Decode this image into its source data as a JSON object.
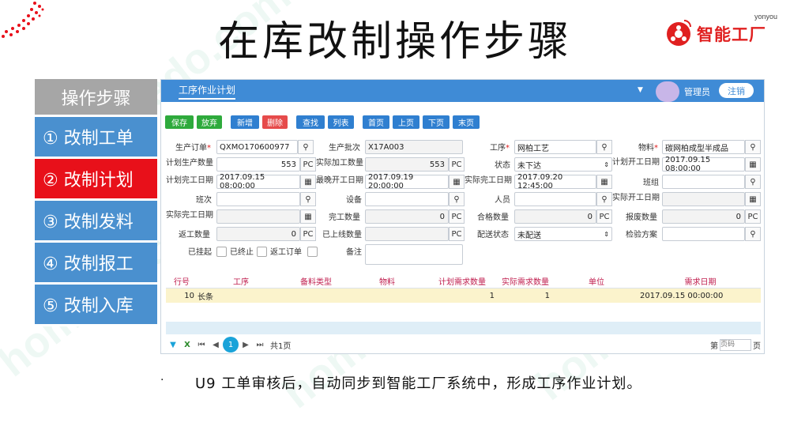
{
  "slide": {
    "title": "在库改制操作步骤",
    "caption_bullet": "·",
    "caption": "U9 工单审核后，自动同步到智能工厂系统中，形成工序作业计划。",
    "watermark": "homedo.com"
  },
  "brand": {
    "top": "yonyou",
    "name": "智能工厂"
  },
  "steps": {
    "header": "操作步骤",
    "items": [
      {
        "label": "① 改制工单",
        "active": false
      },
      {
        "label": "② 改制计划",
        "active": true
      },
      {
        "label": "③ 改制发料",
        "active": false
      },
      {
        "label": "④ 改制报工",
        "active": false
      },
      {
        "label": "⑤ 改制入库",
        "active": false
      }
    ]
  },
  "app": {
    "tab": "工序作业计划",
    "user": "管理员",
    "logout": "注销",
    "toolbar": {
      "save": "保存",
      "discard": "放弃",
      "add": "新增",
      "delete": "删除",
      "search": "查找",
      "list": "列表",
      "first": "首页",
      "prev": "上页",
      "next": "下页",
      "last": "末页"
    },
    "form": {
      "order_label": "生产订单",
      "order": "QXMO170600977",
      "batch_label": "生产批次",
      "batch": "X17A003",
      "process_label": "工序",
      "process": "网柏工艺",
      "material_label": "物料",
      "material": "碳网柏成型半成品",
      "plan_qty_label": "计划生产数量",
      "plan_qty": "553",
      "actual_qty_label": "实际加工数量",
      "actual_qty": "553",
      "status_label": "状态",
      "status": "未下达",
      "plan_start_label": "计划开工日期",
      "plan_start": "2017.09.15 08:00:00",
      "plan_end_label": "计划完工日期",
      "plan_end": "2017.09.15 08:00:00",
      "latest_start_label": "最晚开工日期",
      "latest_start": "2017.09.19 20:00:00",
      "actual_end_label": "实际完工日期",
      "actual_end": "2017.09.20 12:45:00",
      "team_label": "班组",
      "shift_label": "班次",
      "device_label": "设备",
      "person_label": "人员",
      "actual_start_label": "实际开工日期",
      "actual_done_label": "实际完工日期",
      "done_qty_label": "完工数量",
      "done_qty": "0",
      "ok_qty_label": "合格数量",
      "ok_qty": "0",
      "scrap_qty_label": "报废数量",
      "scrap_qty": "0",
      "rework_qty_label": "返工数量",
      "rework_qty": "0",
      "online_qty_label": "已上线数量",
      "delivery_label": "配送状态",
      "delivery": "未配送",
      "inspect_label": "检验方案",
      "suspended_label": "已挂起",
      "ended_label": "已终止",
      "rework_order_label": "返工订单",
      "remark_label": "备注",
      "unit": "PC"
    },
    "grid": {
      "columns": [
        "行号",
        "工序",
        "备料类型",
        "物料",
        "计划需求数量",
        "实际需求数量",
        "单位",
        "需求日期"
      ],
      "rows": [
        [
          "10",
          "长条",
          "",
          "",
          "1",
          "1",
          "",
          "2017.09.15 00:00:00"
        ]
      ]
    },
    "pager": {
      "page": "1",
      "total": "共1页",
      "goto_prefix": "第",
      "goto_placeholder": "页码",
      "goto_suffix": "页"
    }
  }
}
